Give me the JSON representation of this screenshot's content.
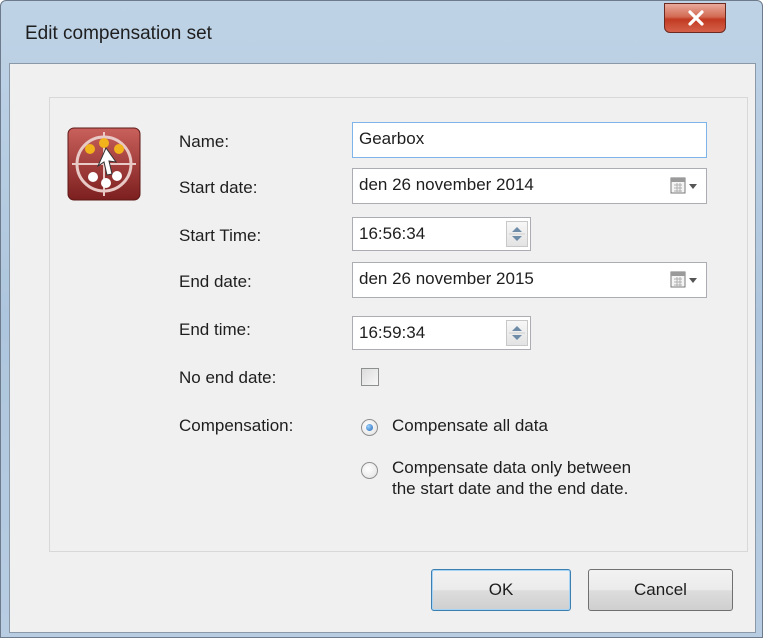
{
  "window": {
    "title": "Edit compensation set",
    "close_icon": "close-icon"
  },
  "form": {
    "name_label": "Name:",
    "name_value": "Gearbox",
    "start_date_label": "Start date:",
    "start_date_value": "den 26 november 2014",
    "start_time_label": "Start Time:",
    "start_time_value": "16:56:34",
    "end_date_label": "End date:",
    "end_date_value": "den 26 november 2015",
    "end_time_label": "End time:",
    "end_time_value": "16:59:34",
    "no_end_date_label": "No end date:",
    "no_end_date_checked": false,
    "compensation_label": "Compensation:",
    "compensation_options": [
      {
        "label": "Compensate all data",
        "selected": true
      },
      {
        "label_line1": "Compensate data only between",
        "label_line2": "the start date and the end date.",
        "selected": false
      }
    ]
  },
  "buttons": {
    "ok_label": "OK",
    "cancel_label": "Cancel"
  },
  "colors": {
    "titlebar": "#b8cde2",
    "close_button": "#c23a22",
    "radio_selected": "#1f64b4"
  }
}
